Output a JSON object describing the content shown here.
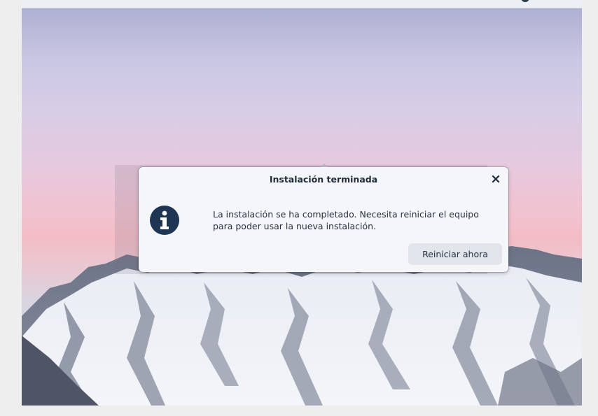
{
  "topbar": {
    "tray_icons": [
      "network-icon",
      "volume-icon",
      "power-icon"
    ]
  },
  "dialog": {
    "title": "Instalación terminada",
    "message_line1": "La instalación se ha completado. Necesita reiniciar el equipo",
    "message_line2": "para poder usar la nueva instalación.",
    "restart_label": "Reiniciar ahora",
    "icon": "info-icon"
  },
  "colors": {
    "dialog_bg": "#f4f6fa",
    "icon_color": "#1e3553",
    "button_bg": "#e2e5ec",
    "text": "#26303e"
  }
}
